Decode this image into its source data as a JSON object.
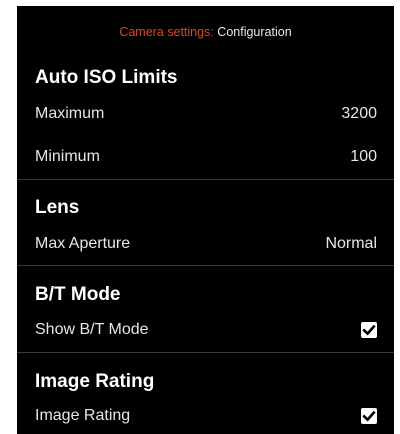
{
  "header": {
    "title_prefix": "Camera settings:",
    "title_page": "Configuration",
    "accent_color": "#d9472b"
  },
  "sections": [
    {
      "title": "Auto ISO Limits",
      "rows": [
        {
          "label": "Maximum",
          "value": "3200"
        },
        {
          "label": "Minimum",
          "value": "100"
        }
      ]
    },
    {
      "title": "Lens",
      "rows": [
        {
          "label": "Max Aperture",
          "value": "Normal"
        }
      ]
    },
    {
      "title": "B/T Mode",
      "rows": [
        {
          "label": "Show B/T Mode",
          "checked": true,
          "icon": "checkmark-icon"
        }
      ]
    },
    {
      "title": "Image Rating",
      "rows": [
        {
          "label": "Image Rating",
          "checked": true,
          "icon": "checkmark-icon"
        }
      ]
    }
  ]
}
